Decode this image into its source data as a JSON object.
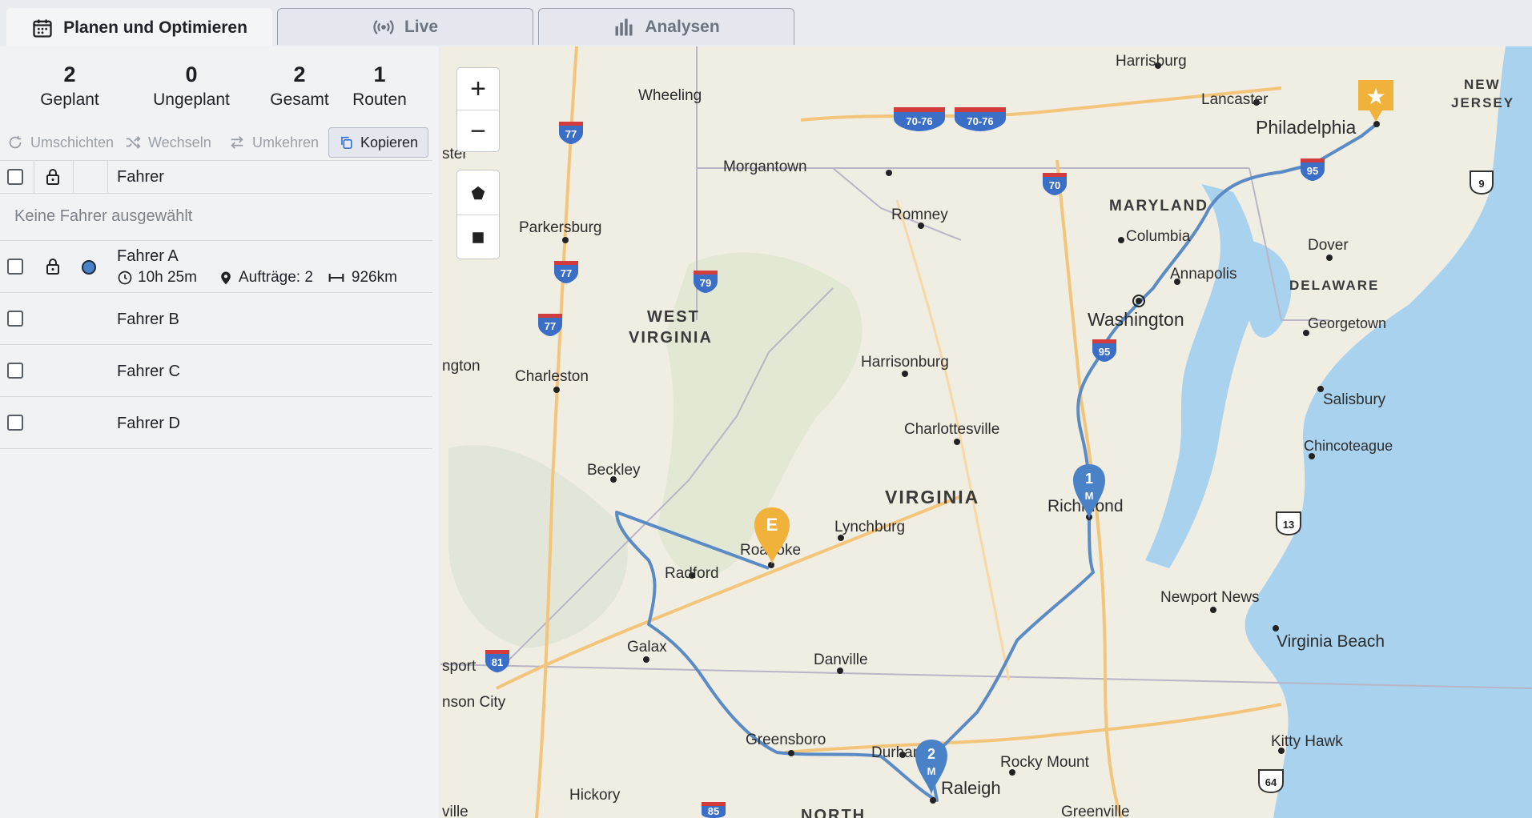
{
  "tabs": [
    {
      "label": "Planen und Optimieren",
      "icon": "calendar-icon"
    },
    {
      "label": "Live",
      "icon": "broadcast-icon"
    },
    {
      "label": "Analysen",
      "icon": "bar-chart-icon"
    }
  ],
  "stats": [
    {
      "value": "2",
      "label": "Geplant"
    },
    {
      "value": "0",
      "label": "Ungeplant"
    },
    {
      "value": "2",
      "label": "Gesamt"
    },
    {
      "value": "1",
      "label": "Routen"
    }
  ],
  "actions": {
    "reshuffle": "Umschichten",
    "swap": "Wechseln",
    "reverse": "Umkehren",
    "copy": "Kopieren"
  },
  "table": {
    "header": "Fahrer",
    "empty_hint": "Keine Fahrer ausgewählt"
  },
  "drivers": [
    {
      "name": "Fahrer A",
      "time": "10h 25m",
      "orders": "Aufträge: 2",
      "distance": "926km",
      "color": "#4a82c8"
    },
    {
      "name": "Fahrer B"
    },
    {
      "name": "Fahrer C"
    },
    {
      "name": "Fahrer D"
    }
  ],
  "map": {
    "zoom_in": "+",
    "zoom_out": "−",
    "markers": {
      "start": "★",
      "end": "E",
      "stop1": "1",
      "stop2": "2",
      "stop_sub": "M"
    },
    "states": [
      "WEST",
      "VIRGINIA",
      "VIRGINIA",
      "MARYLAND",
      "DELAWARE",
      "NEW",
      "JERSEY",
      "NORTH"
    ],
    "cities": [
      "Harrisburg",
      "Lancaster",
      "Philadelphia",
      "Wheeling",
      "Morgantown",
      "Romney",
      "Columbia",
      "Dover",
      "Parkersburg",
      "Annapolis",
      "Washington",
      "Georgetown",
      "Harrisonburg",
      "Charleston",
      "Salisbury",
      "Charlottesville",
      "Chincoteague",
      "Beckley",
      "Lynchburg",
      "Richmond",
      "Roanoke",
      "Radford",
      "Newport News",
      "Virginia Beach",
      "Galax",
      "Danville",
      "Greensboro",
      "Durham",
      "Raleigh",
      "Rocky Mount",
      "Kitty Hawk",
      "Hickory",
      "Greenville",
      "ster",
      "ngton",
      "sport",
      "nson City",
      "ville"
    ],
    "highways": [
      "70-76",
      "70-76",
      "77",
      "70",
      "95",
      "9",
      "77",
      "79",
      "77",
      "95",
      "13",
      "81",
      "64",
      "85"
    ],
    "colors": {
      "route": "#5b8bc4",
      "water": "#a9d2ee",
      "marker_blue": "#4a82c8",
      "marker_orange": "#f0b23a",
      "shield": "#3b6fc7",
      "shield_red": "#d23b3b"
    }
  }
}
